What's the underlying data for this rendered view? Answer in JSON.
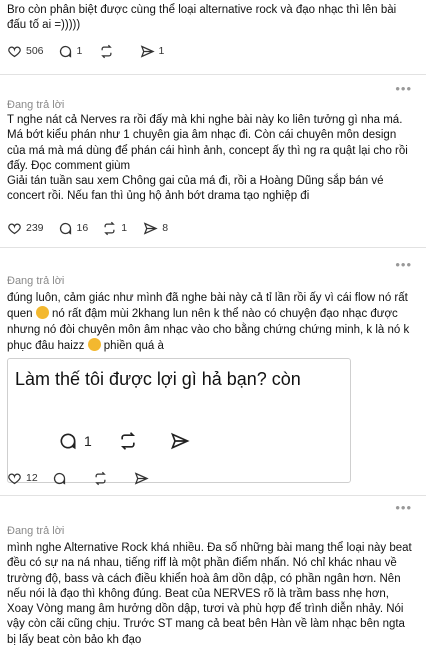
{
  "post0": {
    "text_line1": "Bro còn    phân biệt được cùng thể loại alternative rock và đạo nhạc thì lên bài",
    "text_line2": "đấu tố ai =)))))",
    "likes": "506",
    "replies": "1",
    "reposts": "",
    "shares": "1"
  },
  "post1": {
    "replying": "Đang trả lời",
    "text": "T nghe nát cả Nerves ra rồi đấy mà khi nghe bài này ko liên tưởng gì nha má. Má bớt kiểu phán như 1 chuyên gia âm nhạc đi. Còn cái chuyên môn design của má mà má dùng để phán cái hình ảnh, concept ấy thì ng ra quật lại cho rồi đấy. Đọc comment giùm\nGiải tán tuần sau xem Chông gai của má đi, rồi a Hoàng Dũng sắp bán vé concert rồi. Nếu fan thì ủng hộ ảnh bớt drama tạo nghiệp đi",
    "likes": "239",
    "replies": "16",
    "reposts": "1",
    "shares": "8"
  },
  "post2": {
    "replying": "Đang trả lời",
    "text_a": "đúng luôn, cảm giác như mình đã nghe bài này cả tỉ lần rồi ấy vì cái flow nó rất quen",
    "text_b": "nó rất đậm mùi 2khang lun nên k thể nào có chuyện đạo nhạc được nhưng nó đòi chuyên môn âm nhạc vào cho bằng chứng chứng minh, k là nó k phục đâu haizz",
    "text_c": "phiền quá à",
    "quote_text": "Làm thế tôi được lợi gì hả bạn? còn",
    "quote_replies": "1",
    "likes": "12",
    "replies": "",
    "reposts": "",
    "shares": ""
  },
  "post3": {
    "replying": "Đang trả lời",
    "text": "mình nghe Alternative Rock khá nhiều. Đa số những bài mang thể loại này beat đều có sự na ná nhau, tiếng riff là một phần điểm nhấn. Nó chỉ khác nhau về trường độ, bass và cách điều khiển hoà âm dồn dập, có phần ngân hơn. Nên nếu nói là đạo thì không đúng. Beat của NERVES rõ là trầm bass nhẹ hơn, Xoay Vòng mang âm hưởng dồn dập, tươi và phù hợp để trình diễn nhảy. Nói vậy còn cãi cũng chịu. Trước ST mang cả beat bên Hàn về làm nhạc bên ngta bị lấy beat còn bảo kh đạo"
  },
  "icons": {
    "like": "heart-icon",
    "reply": "comment-icon",
    "repost": "repost-icon",
    "share": "send-icon",
    "more": "more-icon"
  },
  "more_label": "•••"
}
